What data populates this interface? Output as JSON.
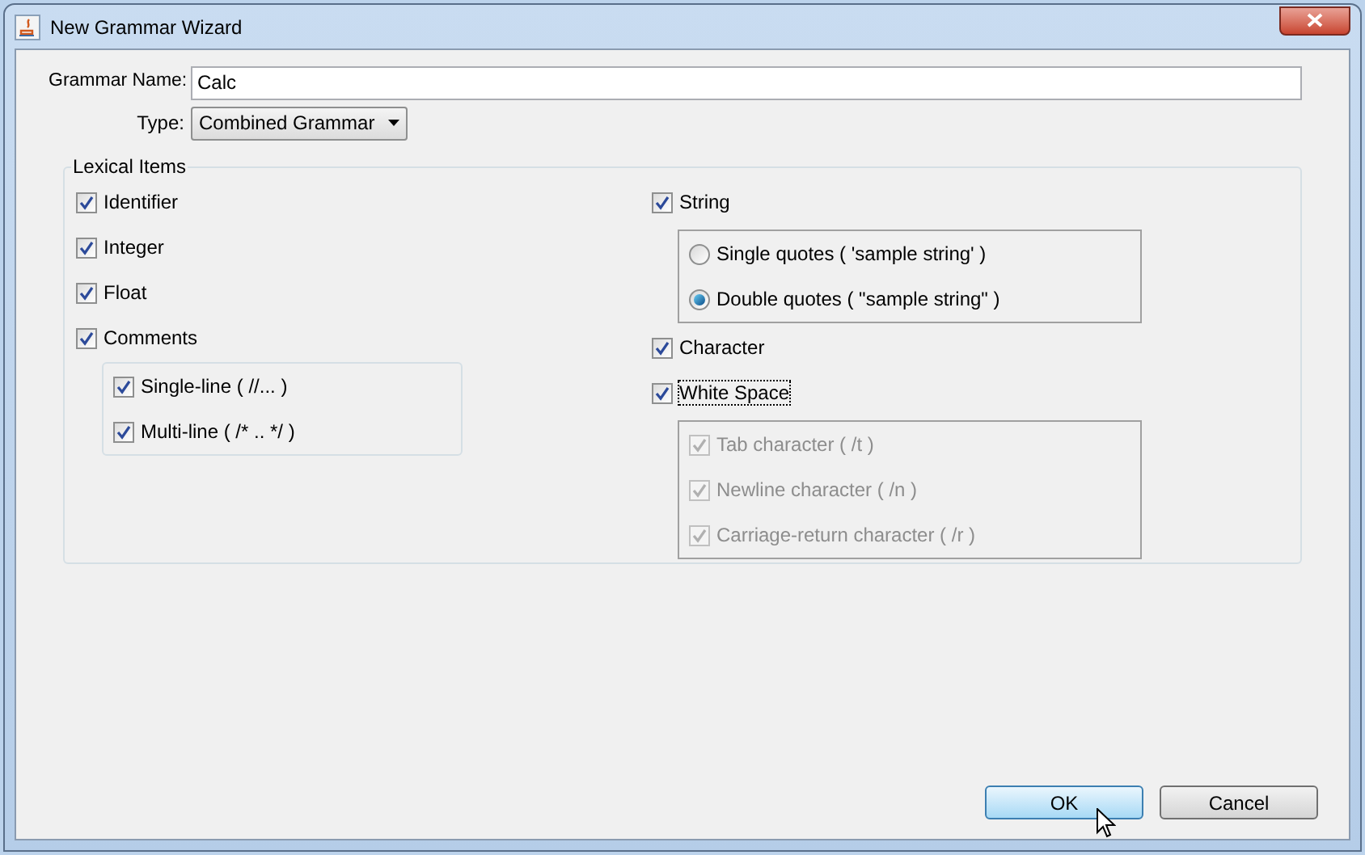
{
  "window": {
    "title": "New Grammar Wizard"
  },
  "grammar_name": {
    "label": "Grammar Name:",
    "value": "Calc"
  },
  "type": {
    "label": "Type:",
    "value": "Combined Grammar"
  },
  "lexical_items": {
    "title": "Lexical Items",
    "left": [
      {
        "label": "Identifier",
        "checked": true,
        "disabled": false,
        "focused": false
      },
      {
        "label": "Integer",
        "checked": true,
        "disabled": false,
        "focused": false
      },
      {
        "label": "Float",
        "checked": true,
        "disabled": false,
        "focused": false
      },
      {
        "label": "Comments",
        "checked": true,
        "disabled": false,
        "focused": false,
        "children": [
          {
            "label": "Single-line ( //... )",
            "checked": true,
            "disabled": false,
            "focused": false
          },
          {
            "label": "Multi-line ( /* .. */ )",
            "checked": true,
            "disabled": false,
            "focused": false
          }
        ]
      }
    ],
    "right": [
      {
        "label": "String",
        "checked": true,
        "disabled": false,
        "focused": false,
        "radios": [
          {
            "label": "Single quotes ( 'sample string' )",
            "selected": false
          },
          {
            "label": "Double quotes ( \"sample string\" )",
            "selected": true
          }
        ]
      },
      {
        "label": "Character",
        "checked": true,
        "disabled": false,
        "focused": false
      },
      {
        "label": "White Space",
        "checked": true,
        "disabled": false,
        "focused": true,
        "children": [
          {
            "label": "Tab character ( /t )",
            "checked": true,
            "disabled": true,
            "focused": false
          },
          {
            "label": "Newline character ( /n )",
            "checked": true,
            "disabled": true,
            "focused": false
          },
          {
            "label": "Carriage-return character ( /r )",
            "checked": true,
            "disabled": true,
            "focused": false
          }
        ]
      }
    ]
  },
  "buttons": [
    {
      "label": "OK",
      "default": true
    },
    {
      "label": "Cancel",
      "default": false
    }
  ]
}
